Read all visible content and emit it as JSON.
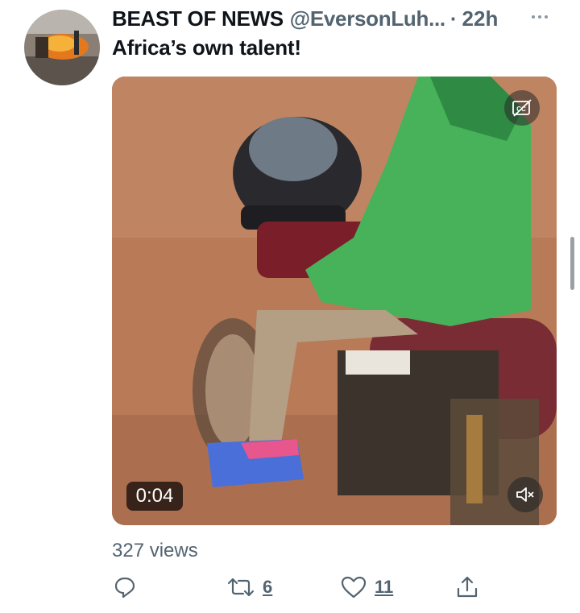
{
  "tweet": {
    "author_name": "BEAST OF NEWS",
    "author_handle": "@EversonLuh...",
    "separator": "·",
    "time_ago": "22h",
    "text": "Africa’s own talent!"
  },
  "media": {
    "duration": "0:04",
    "captions_icon": "cc-icon",
    "mute_icon": "muted-speaker-icon"
  },
  "stats": {
    "views": "327 views"
  },
  "actions": {
    "reply_icon": "reply-icon",
    "retweet_icon": "retweet-icon",
    "retweet_count": "6",
    "like_icon": "heart-icon",
    "like_count": "11",
    "share_icon": "share-icon"
  }
}
